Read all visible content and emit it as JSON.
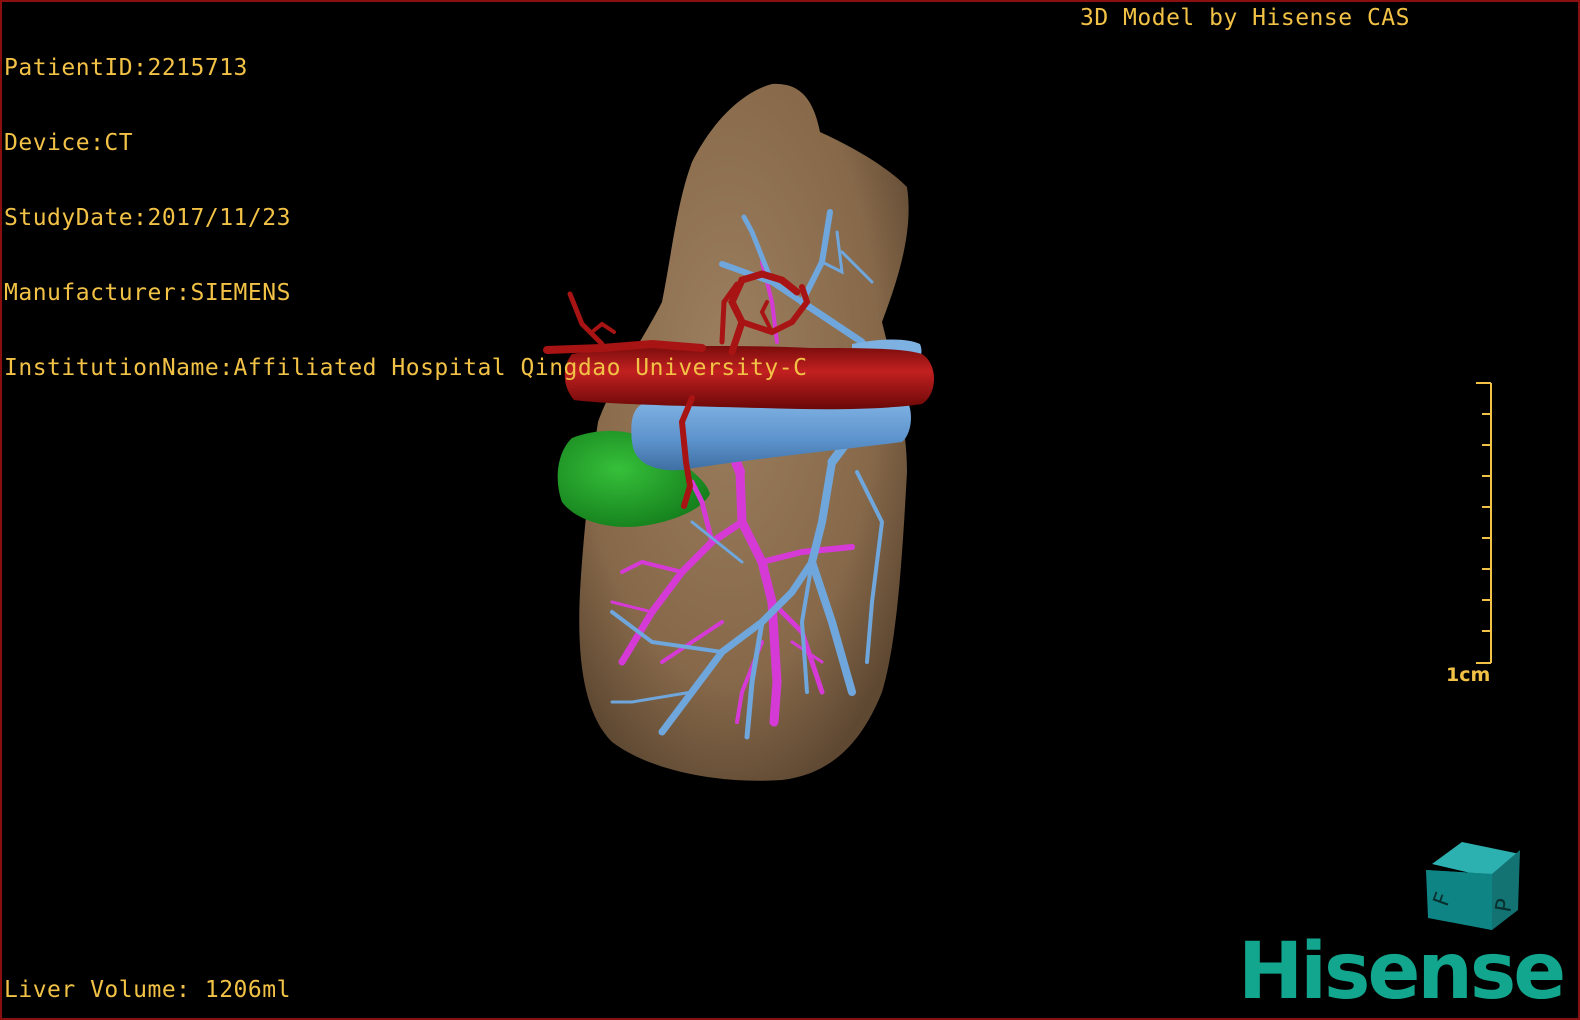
{
  "dicom_info": {
    "patient_id": "PatientID:2215713",
    "device": "Device:CT",
    "study_date": "StudyDate:2017/11/23",
    "manufacturer": "Manufacturer:SIEMENS",
    "institution": "InstitutionName:Affiliated Hospital Qingdao University-C"
  },
  "model_credit": "3D Model by Hisense CAS",
  "liver_volume": "Liver Volume: 1206ml",
  "scale": {
    "label": "1cm"
  },
  "orientation_cube": {
    "faces": [
      "F",
      "P"
    ]
  },
  "logo": "Hisense",
  "colors": {
    "overlay_text": "#f2c246",
    "border": "#8a1010",
    "liver": "#8c7152",
    "portal_vein": "#6fa6dc",
    "hepatic_artery": "#b01616",
    "hepatic_vein": "#d63ad6",
    "lesion": "#1fa62a",
    "logo": "#12a68e"
  }
}
